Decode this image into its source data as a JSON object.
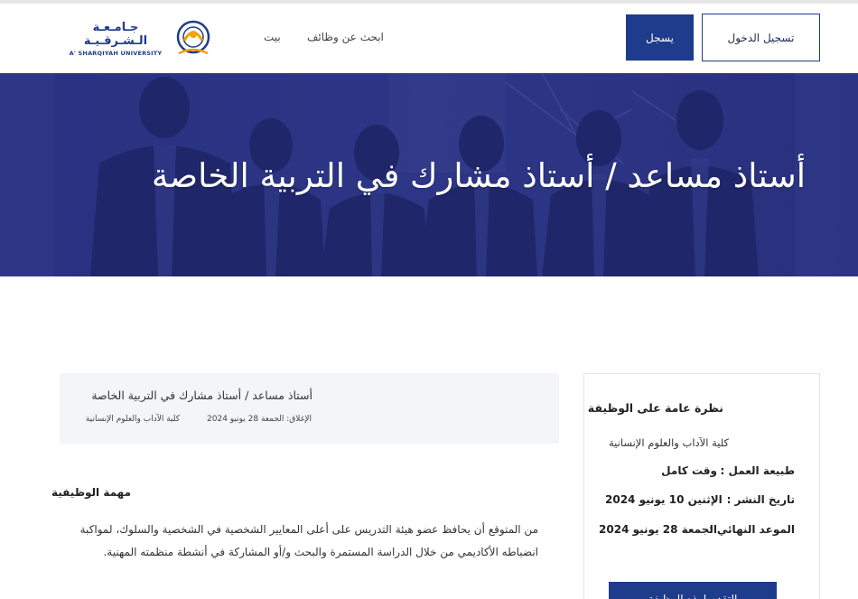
{
  "header": {
    "login_label": "تسجيل الدخول",
    "register_label": "يسجل",
    "nav": {
      "home": "بيت",
      "jobs": "ابحث عن وظائف"
    },
    "logo": {
      "arabic": "جـامـعـة الـشـرقـيـة",
      "english": "A' SHARQIYAH UNIVERSITY"
    }
  },
  "hero": {
    "title": "أستاذ مساعد / أستاذ مشارك في التربية الخاصة"
  },
  "summary": {
    "title": "أستاذ مساعد / أستاذ مشارك في التربية الخاصة",
    "closing": "الإغلاق: الجمعة 28 يونيو 2024",
    "college": "كلية الآداب والعلوم الإنسانية"
  },
  "mission": {
    "heading": "مهمة الوظيفية",
    "text": "من المتوقع أن يحافظ عضو هيئة التدريس على أعلى المعايير الشخصية في الشخصية والسلوك، لمواكبة انضباطه الأكاديمي من خلال الدراسة المستمرة والبحث و/أو المشاركة في أنشطة منظمته المهنية."
  },
  "overview": {
    "title": "نظرة عامة على الوظيفة",
    "college": "كلية الآداب والعلوم الإنسانية",
    "rows": [
      {
        "label": "طبيعة العمل :",
        "value": "وقت كامل"
      },
      {
        "label": "تاريخ النشر :",
        "value": "الإثنين 10 يونيو 2024"
      },
      {
        "label": "الموعد النهائي :",
        "value": "الجمعة 28 يونيو 2024"
      }
    ],
    "apply_label": "التقدم لهذه الوظيفة"
  },
  "colors": {
    "primary": "#1f3b8c",
    "hero_overlay": "#27307a",
    "summary_bg": "#f4f5f9"
  }
}
